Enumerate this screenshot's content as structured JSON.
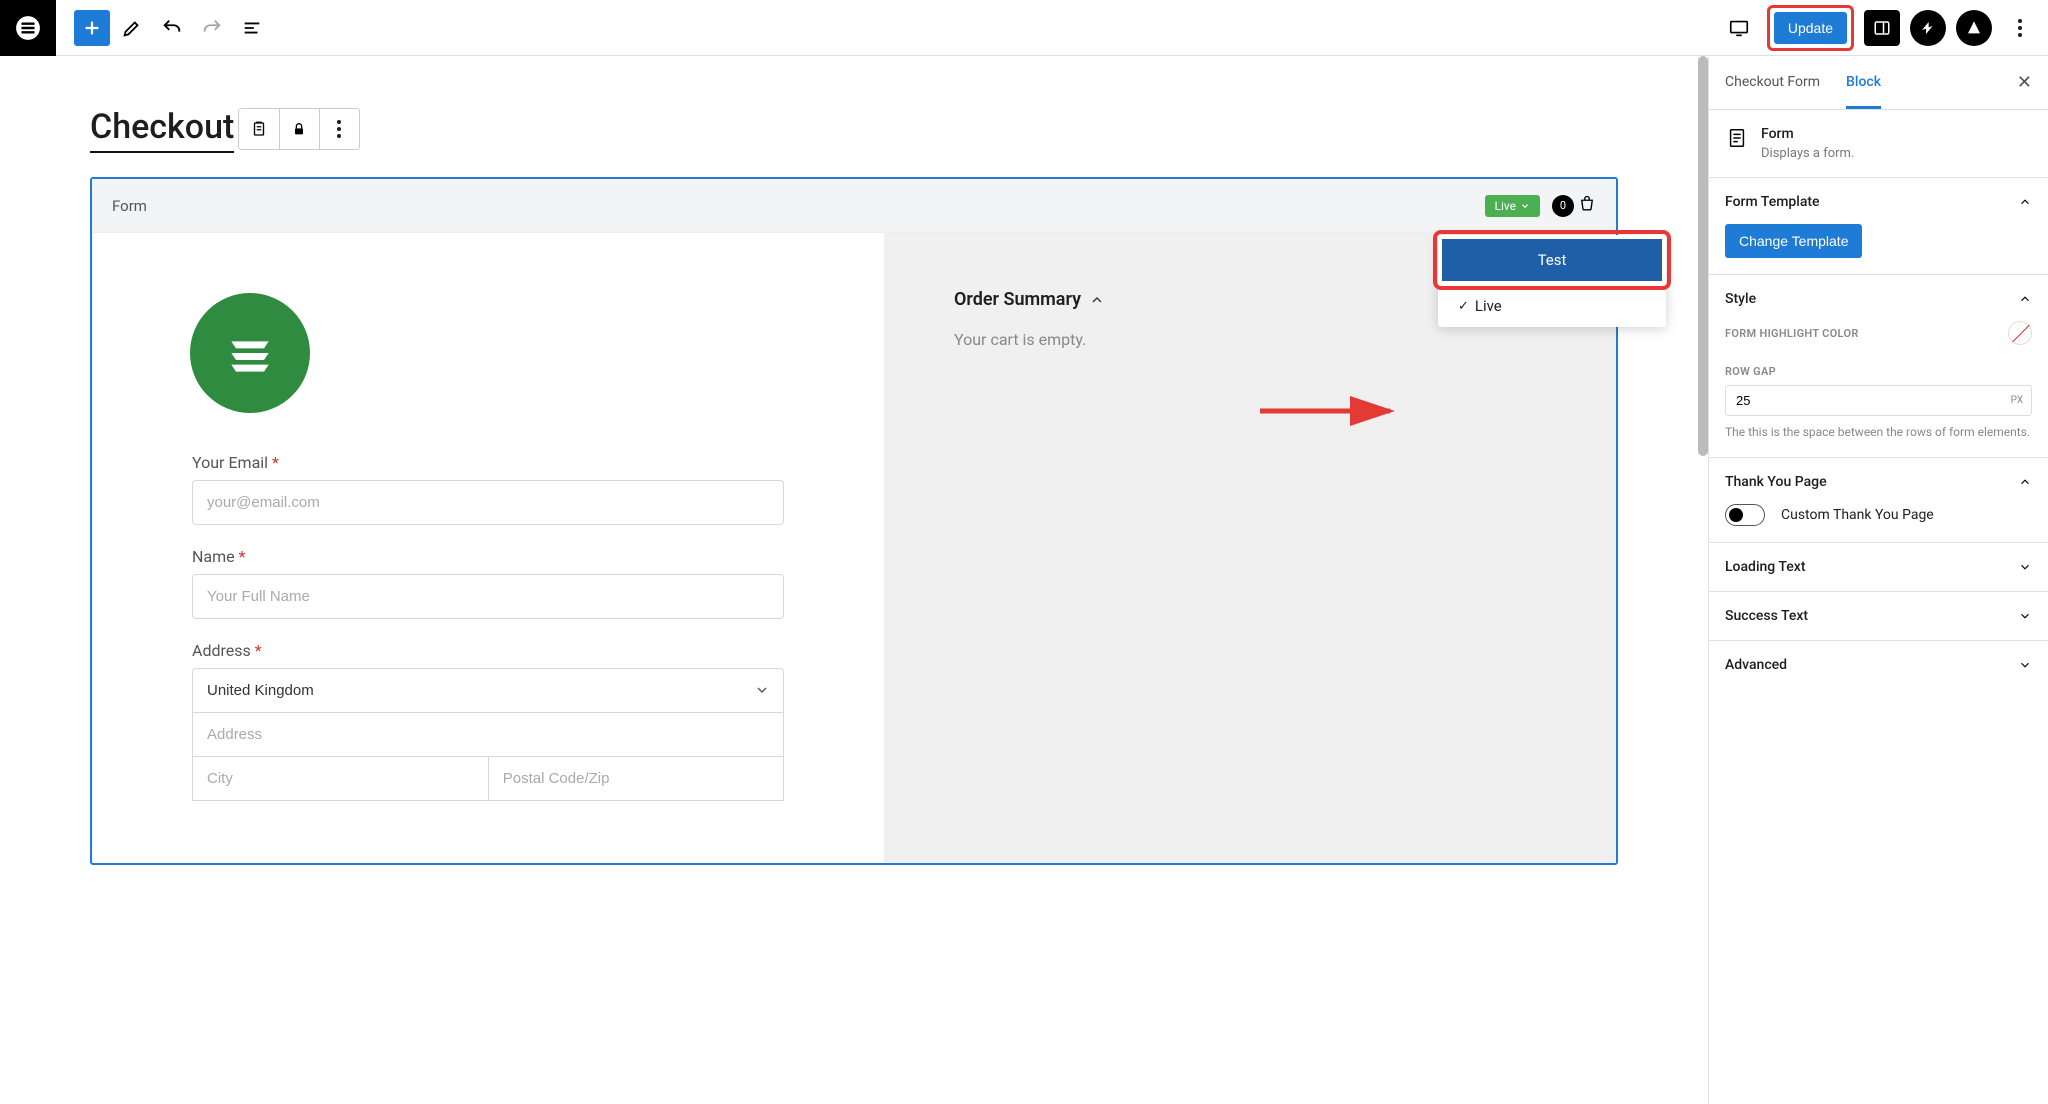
{
  "toolbar": {
    "update_label": "Update"
  },
  "sidebar": {
    "tabs": {
      "main": "Checkout Form",
      "block": "Block"
    },
    "block_info": {
      "title": "Form",
      "desc": "Displays a form."
    },
    "sections": {
      "form_template": {
        "title": "Form Template",
        "button": "Change Template"
      },
      "style": {
        "title": "Style",
        "highlight_label": "FORM HIGHLIGHT COLOR",
        "row_gap_label": "ROW GAP",
        "row_gap_value": "25",
        "row_gap_unit": "PX",
        "row_gap_help": "The this is the space between the rows of form elements."
      },
      "thank_you": {
        "title": "Thank You Page",
        "toggle_label": "Custom Thank You Page"
      },
      "loading": {
        "title": "Loading Text"
      },
      "success": {
        "title": "Success Text"
      },
      "advanced": {
        "title": "Advanced"
      }
    }
  },
  "page": {
    "title": "Checkout",
    "form_header": "Form",
    "live_label": "Live",
    "cart_count": "0",
    "dropdown": {
      "test": "Test",
      "live": "Live"
    },
    "email_label": "Your Email ",
    "email_placeholder": "your@email.com",
    "name_label": "Name ",
    "name_placeholder": "Your Full Name",
    "address_label": "Address ",
    "country_value": "United Kingdom",
    "address_placeholder": "Address",
    "city_placeholder": "City",
    "postal_placeholder": "Postal Code/Zip",
    "summary_title": "Order Summary",
    "summary_empty": "Your cart is empty."
  }
}
